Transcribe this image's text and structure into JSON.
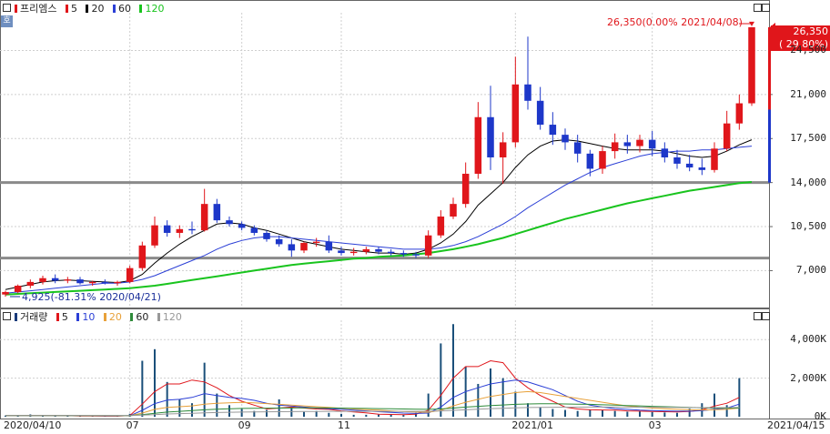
{
  "header": {
    "corner_button": "호"
  },
  "legend_price": {
    "name": "프리엠스",
    "items": [
      {
        "label": "5",
        "color": "#e0161b"
      },
      {
        "label": "20",
        "color": "#000000"
      },
      {
        "label": "60",
        "color": "#2b3fd6"
      },
      {
        "label": "120",
        "color": "#19c41e"
      }
    ]
  },
  "legend_volume": {
    "name": "거래량",
    "items": [
      {
        "label": "5",
        "color": "#e0161b"
      },
      {
        "label": "10",
        "color": "#2b3fd6"
      },
      {
        "label": "20",
        "color": "#e8a13a"
      },
      {
        "label": "60",
        "color": "#2e8b3a"
      },
      {
        "label": "120",
        "color": "#999999"
      }
    ]
  },
  "price_tag": {
    "line1": "26,350",
    "line2": "( 29.80%)"
  },
  "annotations": {
    "high": "26,350(0.00% 2021/04/08)",
    "low": "4,925(-81.31% 2020/04/21)"
  },
  "chart_data": {
    "type": "candlestick",
    "y_price_ticks": [
      "24,500",
      "21,000",
      "17,500",
      "14,000",
      "10,500",
      "7,000"
    ],
    "y_volume_ticks": [
      "4,000K",
      "2,000K",
      "0K"
    ],
    "x_ticks": [
      "2020/04/10",
      "07",
      "09",
      "11",
      "2021/01",
      "03",
      "2021/04/15"
    ],
    "horizontal_lines": [
      14000,
      8000
    ],
    "ylim_price": [
      4500,
      27500
    ],
    "ylim_volume": [
      0,
      5000
    ],
    "price_series": [
      {
        "d": "2020/04",
        "o": 5100,
        "h": 5400,
        "l": 4925,
        "c": 5300
      },
      {
        "d": "",
        "o": 5300,
        "h": 5900,
        "l": 5200,
        "c": 5800
      },
      {
        "d": "",
        "o": 5800,
        "h": 6300,
        "l": 5600,
        "c": 6100
      },
      {
        "d": "",
        "o": 6100,
        "h": 6600,
        "l": 5900,
        "c": 6400
      },
      {
        "d": "",
        "o": 6400,
        "h": 6700,
        "l": 6000,
        "c": 6200
      },
      {
        "d": "",
        "o": 6200,
        "h": 6500,
        "l": 6000,
        "c": 6300
      },
      {
        "d": "",
        "o": 6300,
        "h": 6500,
        "l": 5900,
        "c": 6000
      },
      {
        "d": "",
        "o": 6000,
        "h": 6200,
        "l": 5800,
        "c": 6100
      },
      {
        "d": "",
        "o": 6100,
        "h": 6300,
        "l": 5900,
        "c": 6000
      },
      {
        "d": "",
        "o": 6000,
        "h": 6200,
        "l": 5800,
        "c": 6100
      },
      {
        "d": "2020/07",
        "o": 6100,
        "h": 7400,
        "l": 6000,
        "c": 7200
      },
      {
        "d": "",
        "o": 7200,
        "h": 9300,
        "l": 7000,
        "c": 9000
      },
      {
        "d": "",
        "o": 9000,
        "h": 11300,
        "l": 8800,
        "c": 10600
      },
      {
        "d": "",
        "o": 10600,
        "h": 11000,
        "l": 9700,
        "c": 10000
      },
      {
        "d": "",
        "o": 10000,
        "h": 10600,
        "l": 9600,
        "c": 10300
      },
      {
        "d": "",
        "o": 10300,
        "h": 10900,
        "l": 9900,
        "c": 10200
      },
      {
        "d": "",
        "o": 10200,
        "h": 13500,
        "l": 10100,
        "c": 12300
      },
      {
        "d": "",
        "o": 12300,
        "h": 12700,
        "l": 10800,
        "c": 11000
      },
      {
        "d": "",
        "o": 11000,
        "h": 11300,
        "l": 10500,
        "c": 10700
      },
      {
        "d": "2020/09",
        "o": 10700,
        "h": 10900,
        "l": 10200,
        "c": 10400
      },
      {
        "d": "",
        "o": 10400,
        "h": 10600,
        "l": 9800,
        "c": 10000
      },
      {
        "d": "",
        "o": 10000,
        "h": 10200,
        "l": 9300,
        "c": 9500
      },
      {
        "d": "",
        "o": 9500,
        "h": 9800,
        "l": 8900,
        "c": 9100
      },
      {
        "d": "",
        "o": 9100,
        "h": 9500,
        "l": 8100,
        "c": 8600
      },
      {
        "d": "",
        "o": 8600,
        "h": 9300,
        "l": 8400,
        "c": 9200
      },
      {
        "d": "",
        "o": 9200,
        "h": 9600,
        "l": 8900,
        "c": 9300
      },
      {
        "d": "",
        "o": 9300,
        "h": 9800,
        "l": 8400,
        "c": 8600
      },
      {
        "d": "2020/11",
        "o": 8600,
        "h": 8900,
        "l": 8200,
        "c": 8400
      },
      {
        "d": "",
        "o": 8400,
        "h": 8800,
        "l": 8200,
        "c": 8500
      },
      {
        "d": "",
        "o": 8500,
        "h": 8900,
        "l": 8300,
        "c": 8700
      },
      {
        "d": "",
        "o": 8700,
        "h": 8900,
        "l": 8300,
        "c": 8500
      },
      {
        "d": "",
        "o": 8500,
        "h": 8700,
        "l": 8200,
        "c": 8400
      },
      {
        "d": "",
        "o": 8400,
        "h": 8600,
        "l": 8100,
        "c": 8300
      },
      {
        "d": "",
        "o": 8300,
        "h": 8500,
        "l": 8000,
        "c": 8200
      },
      {
        "d": "",
        "o": 8200,
        "h": 10200,
        "l": 8000,
        "c": 9800
      },
      {
        "d": "",
        "o": 9800,
        "h": 11800,
        "l": 9600,
        "c": 11300
      },
      {
        "d": "",
        "o": 11300,
        "h": 12800,
        "l": 11100,
        "c": 12300
      },
      {
        "d": "",
        "o": 12300,
        "h": 15600,
        "l": 12000,
        "c": 14700
      },
      {
        "d": "",
        "o": 14700,
        "h": 20400,
        "l": 14300,
        "c": 19200
      },
      {
        "d": "",
        "o": 19200,
        "h": 21700,
        "l": 15000,
        "c": 16000
      },
      {
        "d": "",
        "o": 16000,
        "h": 18000,
        "l": 13900,
        "c": 17200
      },
      {
        "d": "2021/01",
        "o": 17200,
        "h": 24000,
        "l": 16800,
        "c": 21800
      },
      {
        "d": "",
        "o": 21800,
        "h": 25600,
        "l": 19800,
        "c": 20500
      },
      {
        "d": "",
        "o": 20500,
        "h": 21600,
        "l": 18200,
        "c": 18600
      },
      {
        "d": "",
        "o": 18600,
        "h": 19600,
        "l": 17000,
        "c": 17800
      },
      {
        "d": "",
        "o": 17800,
        "h": 18300,
        "l": 16600,
        "c": 17200
      },
      {
        "d": "",
        "o": 17200,
        "h": 17800,
        "l": 15600,
        "c": 16300
      },
      {
        "d": "",
        "o": 16300,
        "h": 16600,
        "l": 14500,
        "c": 15100
      },
      {
        "d": "",
        "o": 15100,
        "h": 16900,
        "l": 14700,
        "c": 16500
      },
      {
        "d": "",
        "o": 16500,
        "h": 17900,
        "l": 15900,
        "c": 17200
      },
      {
        "d": "",
        "o": 17200,
        "h": 17800,
        "l": 16300,
        "c": 16900
      },
      {
        "d": "",
        "o": 16900,
        "h": 17800,
        "l": 16400,
        "c": 17400
      },
      {
        "d": "2021/03",
        "o": 17400,
        "h": 18100,
        "l": 16100,
        "c": 16700
      },
      {
        "d": "",
        "o": 16700,
        "h": 17200,
        "l": 15600,
        "c": 16000
      },
      {
        "d": "",
        "o": 16000,
        "h": 16600,
        "l": 15100,
        "c": 15500
      },
      {
        "d": "",
        "o": 15500,
        "h": 16200,
        "l": 14900,
        "c": 15200
      },
      {
        "d": "",
        "o": 15200,
        "h": 15900,
        "l": 14600,
        "c": 15000
      },
      {
        "d": "",
        "o": 15000,
        "h": 17200,
        "l": 14800,
        "c": 16700
      },
      {
        "d": "",
        "o": 16700,
        "h": 19700,
        "l": 16500,
        "c": 18700
      },
      {
        "d": "",
        "o": 18700,
        "h": 21000,
        "l": 18200,
        "c": 20300
      },
      {
        "d": "2021/04/15",
        "o": 20300,
        "h": 26350,
        "l": 20100,
        "c": 26350
      }
    ],
    "ma_series": [
      {
        "name": "20",
        "color": "#000000",
        "values": [
          5500,
          5700,
          5900,
          6100,
          6200,
          6250,
          6200,
          6150,
          6100,
          6050,
          6200,
          6700,
          7600,
          8400,
          9100,
          9700,
          10200,
          10700,
          10800,
          10700,
          10400,
          10200,
          9900,
          9600,
          9300,
          9100,
          8900,
          8700,
          8600,
          8500,
          8400,
          8400,
          8300,
          8400,
          8700,
          9200,
          9900,
          10900,
          12200,
          13100,
          14000,
          15200,
          16200,
          16900,
          17300,
          17400,
          17300,
          17100,
          16900,
          16700,
          16600,
          16600,
          16600,
          16500,
          16300,
          16100,
          16000,
          16100,
          16500,
          17000,
          17400
        ]
      },
      {
        "name": "60",
        "color": "#2b3fd6",
        "values": [
          5200,
          5300,
          5400,
          5500,
          5600,
          5700,
          5800,
          5900,
          6000,
          6000,
          6100,
          6300,
          6600,
          7000,
          7400,
          7800,
          8200,
          8700,
          9100,
          9400,
          9600,
          9700,
          9700,
          9600,
          9500,
          9400,
          9300,
          9200,
          9100,
          9000,
          8900,
          8800,
          8700,
          8700,
          8700,
          8800,
          9000,
          9300,
          9700,
          10200,
          10700,
          11300,
          12000,
          12600,
          13200,
          13800,
          14300,
          14800,
          15200,
          15500,
          15800,
          16100,
          16300,
          16400,
          16500,
          16500,
          16600,
          16600,
          16700,
          16800,
          16900
        ]
      },
      {
        "name": "120",
        "color": "#19c41e",
        "values": [
          5100,
          5150,
          5200,
          5250,
          5300,
          5350,
          5400,
          5450,
          5500,
          5550,
          5600,
          5700,
          5800,
          5950,
          6100,
          6250,
          6400,
          6550,
          6700,
          6850,
          7000,
          7150,
          7300,
          7450,
          7550,
          7650,
          7750,
          7850,
          7950,
          8000,
          8100,
          8150,
          8200,
          8300,
          8400,
          8550,
          8700,
          8900,
          9100,
          9350,
          9600,
          9900,
          10200,
          10500,
          10800,
          11100,
          11350,
          11600,
          11850,
          12100,
          12350,
          12550,
          12750,
          12950,
          13150,
          13350,
          13500,
          13650,
          13800,
          13950,
          14050
        ]
      }
    ],
    "volume_series": [
      60,
      40,
      120,
      30,
      30,
      40,
      25,
      20,
      20,
      30,
      150,
      2900,
      3500,
      1800,
      900,
      700,
      2800,
      1200,
      600,
      400,
      300,
      350,
      900,
      500,
      250,
      300,
      200,
      150,
      100,
      100,
      110,
      100,
      90,
      200,
      1200,
      3800,
      4800,
      2600,
      1700,
      2500,
      2000,
      1300,
      700,
      500,
      400,
      350,
      300,
      380,
      330,
      300,
      260,
      280,
      240,
      220,
      200,
      420,
      700,
      1200,
      600,
      2000
    ],
    "volume_ma": [
      {
        "name": "5",
        "color": "#e0161b",
        "values": [
          60,
          55,
          70,
          65,
          60,
          50,
          40,
          35,
          30,
          30,
          60,
          650,
          1300,
          1700,
          1700,
          1900,
          1800,
          1500,
          1100,
          800,
          600,
          400,
          450,
          500,
          450,
          400,
          380,
          300,
          250,
          200,
          130,
          120,
          110,
          130,
          340,
          1100,
          2000,
          2600,
          2600,
          2900,
          2800,
          2000,
          1500,
          1100,
          800,
          500,
          400,
          360,
          350,
          340,
          300,
          290,
          270,
          260,
          250,
          270,
          360,
          550,
          700,
          1000
        ]
      },
      {
        "name": "10",
        "color": "#2b3fd6",
        "values": [
          60,
          55,
          62,
          60,
          58,
          56,
          52,
          48,
          44,
          42,
          50,
          330,
          680,
          860,
          900,
          1000,
          1200,
          1100,
          1000,
          950,
          850,
          700,
          600,
          550,
          500,
          450,
          420,
          380,
          340,
          300,
          260,
          220,
          190,
          170,
          190,
          500,
          1000,
          1300,
          1500,
          1700,
          1800,
          1900,
          1800,
          1600,
          1400,
          1100,
          800,
          600,
          500,
          420,
          380,
          340,
          320,
          300,
          290,
          290,
          310,
          380,
          450,
          650
        ]
      },
      {
        "name": "20",
        "color": "#e8a13a",
        "values": [
          60,
          58,
          60,
          58,
          56,
          55,
          54,
          52,
          50,
          48,
          50,
          190,
          380,
          480,
          520,
          560,
          650,
          700,
          720,
          740,
          720,
          680,
          640,
          600,
          560,
          520,
          480,
          440,
          400,
          370,
          340,
          300,
          270,
          240,
          230,
          330,
          560,
          750,
          900,
          1050,
          1150,
          1250,
          1300,
          1250,
          1150,
          1050,
          950,
          850,
          750,
          650,
          560,
          500,
          450,
          410,
          380,
          360,
          350,
          360,
          380,
          450
        ]
      },
      {
        "name": "60",
        "color": "#2e8b3a",
        "values": [
          60,
          60,
          60,
          60,
          60,
          60,
          60,
          60,
          60,
          60,
          60,
          110,
          180,
          240,
          280,
          320,
          360,
          390,
          410,
          430,
          440,
          445,
          450,
          455,
          460,
          460,
          455,
          450,
          440,
          430,
          420,
          410,
          400,
          390,
          380,
          400,
          450,
          500,
          540,
          580,
          610,
          640,
          660,
          670,
          670,
          660,
          650,
          640,
          620,
          600,
          580,
          560,
          540,
          520,
          500,
          480,
          460,
          450,
          445,
          450
        ]
      },
      {
        "name": "120",
        "color": "#999999",
        "values": [
          60,
          60,
          60,
          60,
          60,
          60,
          60,
          60,
          60,
          60,
          60,
          85,
          110,
          140,
          160,
          180,
          200,
          215,
          230,
          240,
          250,
          255,
          260,
          265,
          270,
          275,
          280,
          280,
          280,
          280,
          280,
          280,
          280,
          280,
          285,
          300,
          330,
          360,
          390,
          420,
          440,
          460,
          475,
          485,
          490,
          495,
          497,
          500,
          500,
          500,
          500,
          495,
          490,
          485,
          480,
          475,
          470,
          470,
          470,
          480
        ]
      }
    ]
  }
}
